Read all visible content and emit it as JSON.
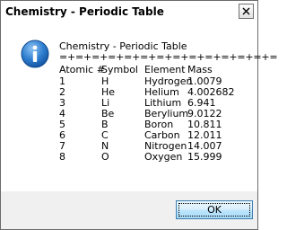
{
  "window": {
    "title": "Chemistry - Periodic Table"
  },
  "titlebar": {
    "close_glyph": "close-icon"
  },
  "message": {
    "icon": "info-icon",
    "title": "Chemistry - Periodic Table",
    "separator": "=+=+=+=+=+=+=+=+=+=+=+=+=+=",
    "headers": {
      "atomic": "Atomic #",
      "symbol": "Symbol",
      "element": "Element",
      "mass": "Mass"
    },
    "rows": [
      {
        "atomic": "1",
        "symbol": "H",
        "element": "Hydrogen",
        "mass": "1.0079"
      },
      {
        "atomic": "2",
        "symbol": "He",
        "element": "Helium",
        "mass": "4.002682"
      },
      {
        "atomic": "3",
        "symbol": "Li",
        "element": "Lithium",
        "mass": "6.941"
      },
      {
        "atomic": "4",
        "symbol": "Be",
        "element": "Berylium",
        "mass": "9.0122"
      },
      {
        "atomic": "5",
        "symbol": "B",
        "element": "Boron",
        "mass": "10.811"
      },
      {
        "atomic": "6",
        "symbol": "C",
        "element": "Carbon",
        "mass": "12.011"
      },
      {
        "atomic": "7",
        "symbol": "N",
        "element": "Nitrogen",
        "mass": "14.007"
      },
      {
        "atomic": "8",
        "symbol": "O",
        "element": "Oxygen",
        "mass": "15.999"
      }
    ]
  },
  "buttons": {
    "ok_label": "OK"
  },
  "colors": {
    "info_icon": "#1e6fc4",
    "button_border": "#3c7fb1"
  }
}
